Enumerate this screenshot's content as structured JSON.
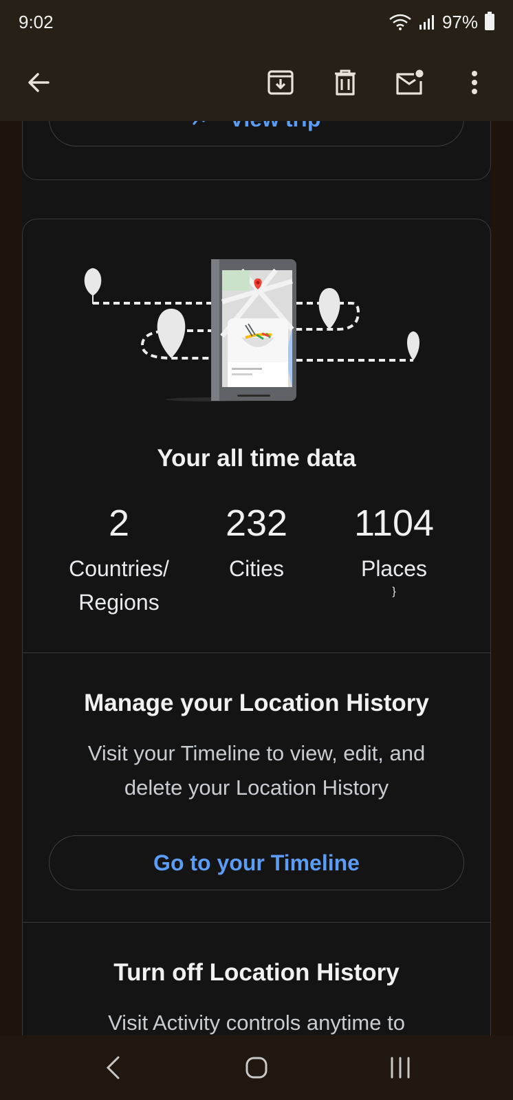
{
  "status_bar": {
    "time": "9:02",
    "battery": "97%"
  },
  "app_bar": {
    "icons": [
      "back-arrow-icon",
      "archive-icon",
      "delete-icon",
      "mark-unread-icon",
      "more-vert-icon"
    ]
  },
  "trip_card": {
    "view_trip_label": "View trip"
  },
  "stats_card": {
    "title": "Your all time data",
    "stats": [
      {
        "value": "2",
        "label_line1": "Countries/",
        "label_line2": "Regions"
      },
      {
        "value": "232",
        "label_line1": "Cities",
        "label_line2": ""
      },
      {
        "value": "1104",
        "label_line1": "Places",
        "label_line2": ""
      }
    ]
  },
  "manage_section": {
    "title": "Manage your Location History",
    "description_line1": "Visit your Timeline to view, edit, and",
    "description_line2": "delete your Location History",
    "button_label": "Go to your Timeline"
  },
  "turn_off_section": {
    "title": "Turn off Location History",
    "description_partial": "Visit Activity controls anytime to"
  },
  "colors": {
    "accent_blue": "#5b9cf5",
    "card_bg": "#141414",
    "bar_bg": "#272016"
  }
}
